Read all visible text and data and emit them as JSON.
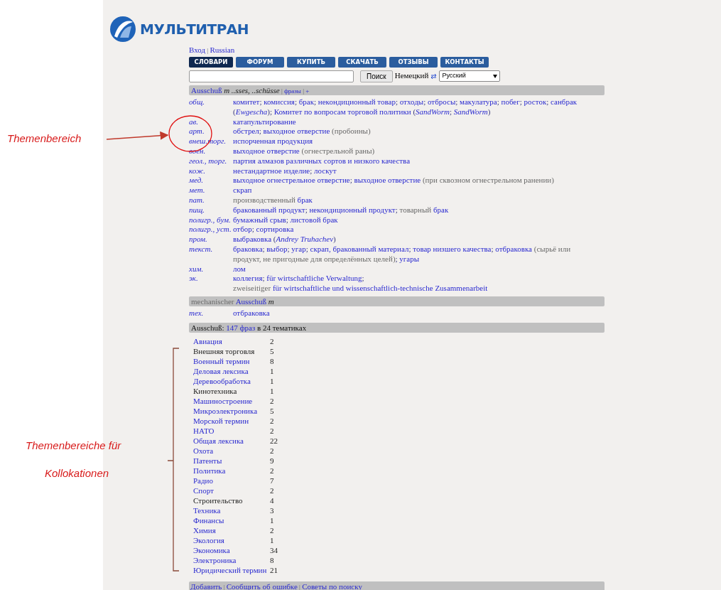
{
  "logo": {
    "text": "МУЛЬТИТРАН"
  },
  "top_links": [
    {
      "kind": "link",
      "text": "Вход"
    },
    {
      "kind": "small",
      "text": " | "
    },
    {
      "kind": "link",
      "text": "Russian"
    }
  ],
  "tabs": [
    {
      "label": "СЛОВАРИ",
      "selected": true
    },
    {
      "label": "ФОРУМ",
      "selected": false
    },
    {
      "label": "КУПИТЬ",
      "selected": false
    },
    {
      "label": "СКАЧАТЬ",
      "selected": false
    },
    {
      "label": "ОТЗЫВЫ",
      "selected": false
    },
    {
      "label": "КОНТАКТЫ",
      "selected": false
    }
  ],
  "search": {
    "button": "Поиск",
    "source_language": "Немецкий",
    "target_language": "Русский"
  },
  "sections": [
    {
      "heading": [
        {
          "kind": "link",
          "text": "Ausschuß"
        },
        {
          "kind": "gram",
          "text": " m ..sses, ..schüsse"
        },
        {
          "kind": "small",
          "text": " | "
        },
        {
          "kind": "small-link",
          "text": "фразы"
        },
        {
          "kind": "small",
          "text": " | "
        },
        {
          "kind": "small-link",
          "text": "+"
        }
      ],
      "entries": [
        {
          "subject": "общ.",
          "parts": [
            {
              "kind": "link",
              "text": "комитет"
            },
            {
              "kind": "punct",
              "text": "; "
            },
            {
              "kind": "link",
              "text": "комиссия"
            },
            {
              "kind": "punct",
              "text": "; "
            },
            {
              "kind": "link",
              "text": "брак"
            },
            {
              "kind": "punct",
              "text": "; "
            },
            {
              "kind": "link",
              "text": "некондиционный товар"
            },
            {
              "kind": "punct",
              "text": "; "
            },
            {
              "kind": "link",
              "text": "отходы"
            },
            {
              "kind": "punct",
              "text": "; "
            },
            {
              "kind": "link",
              "text": "отбросы"
            },
            {
              "kind": "punct",
              "text": "; "
            },
            {
              "kind": "link",
              "text": "макулатура"
            },
            {
              "kind": "punct",
              "text": "; "
            },
            {
              "kind": "link",
              "text": "побег"
            },
            {
              "kind": "punct",
              "text": "; "
            },
            {
              "kind": "link",
              "text": "росток"
            },
            {
              "kind": "punct",
              "text": "; "
            },
            {
              "kind": "link",
              "text": "санбрак"
            },
            {
              "kind": "punct",
              "text": " ("
            },
            {
              "kind": "author",
              "text": "Ewgescha"
            },
            {
              "kind": "punct",
              "text": "); "
            },
            {
              "kind": "link",
              "text": "Комитет по вопросам торговой политики"
            },
            {
              "kind": "punct",
              "text": " ("
            },
            {
              "kind": "author",
              "text": "SandWorm"
            },
            {
              "kind": "punct",
              "text": "; "
            },
            {
              "kind": "author",
              "text": "SandWorm"
            },
            {
              "kind": "punct",
              "text": ")"
            }
          ]
        },
        {
          "subject": "ав.",
          "parts": [
            {
              "kind": "link",
              "text": "катапультирование"
            }
          ]
        },
        {
          "subject": "арт.",
          "parts": [
            {
              "kind": "link",
              "text": "обстрел"
            },
            {
              "kind": "punct",
              "text": "; "
            },
            {
              "kind": "link",
              "text": "выходное отверстие"
            },
            {
              "kind": "note",
              "text": " (пробоины)"
            }
          ]
        },
        {
          "subject": "внеш.торг.",
          "parts": [
            {
              "kind": "link",
              "text": "испорченная продукция"
            }
          ]
        },
        {
          "subject": "воен.",
          "parts": [
            {
              "kind": "link",
              "text": "выходное отверстие"
            },
            {
              "kind": "note",
              "text": " (огнестрельной раны)"
            }
          ]
        },
        {
          "subject": "геол., торг.",
          "parts": [
            {
              "kind": "link",
              "text": "партия алмазов различных сортов и низкого качества"
            }
          ]
        },
        {
          "subject": "кож.",
          "parts": [
            {
              "kind": "link",
              "text": "нестандартное изделие"
            },
            {
              "kind": "punct",
              "text": "; "
            },
            {
              "kind": "link",
              "text": "лоскут"
            }
          ]
        },
        {
          "subject": "мед.",
          "parts": [
            {
              "kind": "link",
              "text": "выходное огнестрельное отверстие"
            },
            {
              "kind": "punct",
              "text": "; "
            },
            {
              "kind": "link",
              "text": "выходное отверстие"
            },
            {
              "kind": "note",
              "text": " (при сквозном огнестрельном ранении)"
            }
          ]
        },
        {
          "subject": "мет.",
          "parts": [
            {
              "kind": "link",
              "text": "скрап"
            }
          ]
        },
        {
          "subject": "пат.",
          "parts": [
            {
              "kind": "note",
              "text": "производственный "
            },
            {
              "kind": "link",
              "text": "брак"
            }
          ]
        },
        {
          "subject": "пищ.",
          "parts": [
            {
              "kind": "link",
              "text": "бракованный продукт"
            },
            {
              "kind": "punct",
              "text": "; "
            },
            {
              "kind": "link",
              "text": "некондиционный продукт"
            },
            {
              "kind": "punct",
              "text": "; "
            },
            {
              "kind": "note",
              "text": "товарный "
            },
            {
              "kind": "link",
              "text": "брак"
            }
          ]
        },
        {
          "subject": "полигр., бум.",
          "parts": [
            {
              "kind": "link",
              "text": "бумажный срыв"
            },
            {
              "kind": "punct",
              "text": "; "
            },
            {
              "kind": "link",
              "text": "листовой брак"
            }
          ]
        },
        {
          "subject": "полигр., уст.",
          "parts": [
            {
              "kind": "link",
              "text": "отбор"
            },
            {
              "kind": "punct",
              "text": "; "
            },
            {
              "kind": "link",
              "text": "сортировка"
            }
          ]
        },
        {
          "subject": "пром.",
          "parts": [
            {
              "kind": "link",
              "text": "выбраковка"
            },
            {
              "kind": "punct",
              "text": " ("
            },
            {
              "kind": "author",
              "text": "Andrey Truhachev"
            },
            {
              "kind": "punct",
              "text": ")"
            }
          ]
        },
        {
          "subject": "текст.",
          "parts": [
            {
              "kind": "link",
              "text": "браковка"
            },
            {
              "kind": "punct",
              "text": "; "
            },
            {
              "kind": "link",
              "text": "выбор"
            },
            {
              "kind": "punct",
              "text": "; "
            },
            {
              "kind": "link",
              "text": "угар"
            },
            {
              "kind": "punct",
              "text": "; "
            },
            {
              "kind": "link",
              "text": "скрап, бракованный материал"
            },
            {
              "kind": "punct",
              "text": "; "
            },
            {
              "kind": "link",
              "text": "товар низшего качества"
            },
            {
              "kind": "punct",
              "text": "; "
            },
            {
              "kind": "link",
              "text": "отбраковка"
            },
            {
              "kind": "note",
              "text": " (сырьё или"
            },
            {
              "kind": "note",
              "text": " продукт, не пригодные для определённых целей)"
            },
            {
              "kind": "punct",
              "text": "; "
            },
            {
              "kind": "link",
              "text": "угары"
            }
          ]
        },
        {
          "subject": "хим.",
          "parts": [
            {
              "kind": "link",
              "text": "лом"
            }
          ]
        },
        {
          "subject": "эк.",
          "parts": [
            {
              "kind": "link",
              "text": "коллегия"
            },
            {
              "kind": "punct",
              "text": "; "
            },
            {
              "kind": "link",
              "text": "für wirtschaftliche Verwaltung"
            },
            {
              "kind": "punct",
              "text": "; "
            },
            {
              "kind": "note",
              "text": "zweiseitiger "
            },
            {
              "kind": "link",
              "text": "für wirtschaftliche und wissenschaftlich-technische Zusammenarbeit"
            }
          ]
        }
      ]
    },
    {
      "heading": [
        {
          "kind": "note",
          "text": "mechanischer "
        },
        {
          "kind": "link",
          "text": "Ausschuß"
        },
        {
          "kind": "gram",
          "text": " m"
        }
      ],
      "entries": [
        {
          "subject": "тех.",
          "parts": [
            {
              "kind": "link",
              "text": "отбраковка"
            }
          ]
        }
      ]
    }
  ],
  "phrases": {
    "heading": [
      {
        "kind": "plain",
        "text": "Ausschuß: "
      },
      {
        "kind": "link",
        "text": "147 фраз"
      },
      {
        "kind": "plain",
        "text": " в 24 тематиках"
      }
    ],
    "topics": [
      {
        "name": "Авиация",
        "count": "2",
        "linked": true
      },
      {
        "name": "Внешняя торговля",
        "count": "5",
        "linked": false
      },
      {
        "name": "Военный термин",
        "count": "8",
        "linked": true
      },
      {
        "name": "Деловая лексика",
        "count": "1",
        "linked": true
      },
      {
        "name": "Деревообработка",
        "count": "1",
        "linked": true
      },
      {
        "name": "Кинотехника",
        "count": "1",
        "linked": false
      },
      {
        "name": "Машиностроение",
        "count": "2",
        "linked": true
      },
      {
        "name": "Микроэлектроника",
        "count": "5",
        "linked": true
      },
      {
        "name": "Морской термин",
        "count": "2",
        "linked": true
      },
      {
        "name": "НАТО",
        "count": "2",
        "linked": true
      },
      {
        "name": "Общая лексика",
        "count": "22",
        "linked": true
      },
      {
        "name": "Охота",
        "count": "2",
        "linked": true
      },
      {
        "name": "Патенты",
        "count": "9",
        "linked": true
      },
      {
        "name": "Политика",
        "count": "2",
        "linked": true
      },
      {
        "name": "Радио",
        "count": "7",
        "linked": true
      },
      {
        "name": "Спорт",
        "count": "2",
        "linked": true
      },
      {
        "name": "Строительство",
        "count": "4",
        "linked": false
      },
      {
        "name": "Техника",
        "count": "3",
        "linked": true
      },
      {
        "name": "Финансы",
        "count": "1",
        "linked": true
      },
      {
        "name": "Химия",
        "count": "2",
        "linked": true
      },
      {
        "name": "Экология",
        "count": "1",
        "linked": true
      },
      {
        "name": "Экономика",
        "count": "34",
        "linked": true
      },
      {
        "name": "Электроника",
        "count": "8",
        "linked": true
      },
      {
        "name": "Юридический термин",
        "count": "21",
        "linked": true
      }
    ]
  },
  "footer_links": [
    {
      "kind": "link",
      "text": "Добавить"
    },
    {
      "kind": "small",
      "text": " | "
    },
    {
      "kind": "link",
      "text": "Сообщить об ошибке"
    },
    {
      "kind": "small",
      "text": " | "
    },
    {
      "kind": "link",
      "text": "Советы по поиску"
    }
  ],
  "annotations": [
    {
      "text": "Themenbereich"
    },
    {
      "text": "Themenbereiche für"
    },
    {
      "text": "Kollokationen"
    }
  ]
}
